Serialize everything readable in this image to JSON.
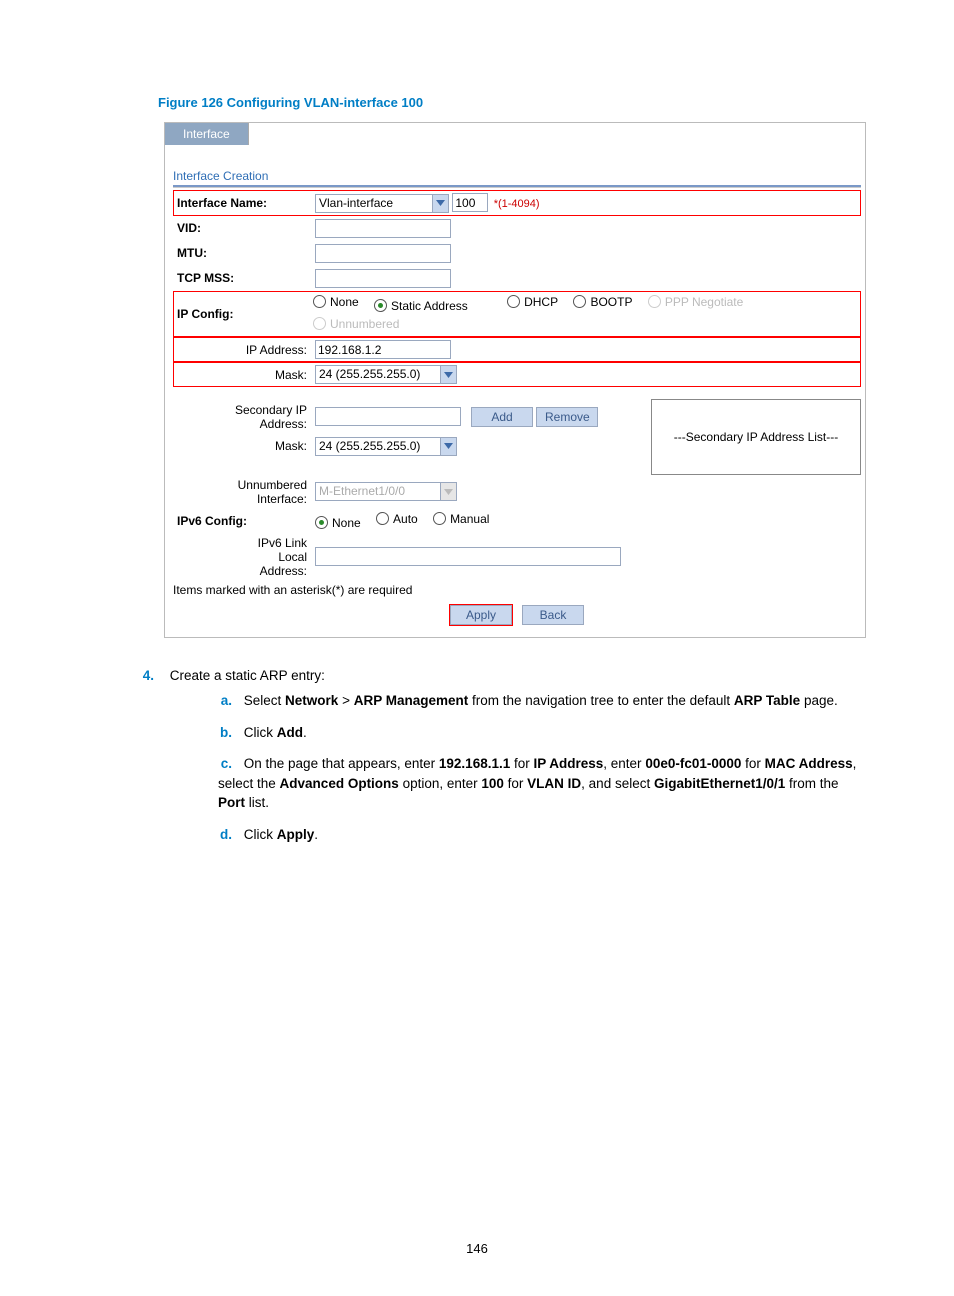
{
  "figure_caption": "Figure 126 Configuring VLAN-interface 100",
  "tab_label": "Interface",
  "section_title": "Interface Creation",
  "labels": {
    "interface_name": "Interface Name:",
    "vid": "VID:",
    "mtu": "MTU:",
    "tcp_mss": "TCP MSS:",
    "ip_config": "IP Config:",
    "ip_address": "IP Address:",
    "mask": "Mask:",
    "secondary_ip": "Secondary IP\nAddress:",
    "mask2": "Mask:",
    "unnumbered_if": "Unnumbered\nInterface:",
    "ipv6_config": "IPv6 Config:",
    "ipv6_link": "IPv6 Link\nLocal\nAddress:"
  },
  "fields": {
    "interface_type": "Vlan-interface",
    "interface_id": "100",
    "interface_id_hint": "*(1-4094)",
    "vid": "",
    "mtu": "",
    "tcp_mss": "",
    "ip_address": "192.168.1.2",
    "mask": "24 (255.255.255.0)",
    "secondary_ip": "",
    "mask2": "24 (255.255.255.0)",
    "unnumbered_if": "M-Ethernet1/0/0",
    "ipv6_link": ""
  },
  "ip_config_options": {
    "none": "None",
    "static": "Static Address",
    "dhcp": "DHCP",
    "bootp": "BOOTP",
    "ppp": "PPP Negotiate",
    "unnumbered": "Unnumbered"
  },
  "ipv6_options": {
    "none": "None",
    "auto": "Auto",
    "manual": "Manual"
  },
  "secondary_list_header": "---Secondary IP Address List---",
  "buttons": {
    "add": "Add",
    "remove": "Remove",
    "apply": "Apply",
    "back": "Back"
  },
  "footnote": "Items marked with an asterisk(*) are required",
  "steps": {
    "num": "4.",
    "title": "Create a static ARP entry:",
    "a": {
      "k": "a.",
      "pre": "Select ",
      "b1": "Network",
      "mid1": " > ",
      "b2": "ARP Management",
      "mid2": " from the navigation tree to enter the default ",
      "b3": "ARP Table",
      "post": " page."
    },
    "b": {
      "k": "b.",
      "pre": "Click ",
      "b1": "Add",
      "post": "."
    },
    "c": {
      "k": "c.",
      "t1": "On the page that appears, enter ",
      "b1": "192.168.1.1",
      "t2": " for ",
      "b2": "IP Address",
      "t3": ", enter ",
      "b3": "00e0-fc01-0000",
      "t4": " for ",
      "b4": "MAC Address",
      "t5": ", select the ",
      "b5": "Advanced Options",
      "t6": " option, enter ",
      "b6": "100",
      "t7": " for ",
      "b7": "VLAN ID",
      "t8": ", and select ",
      "b8": "GigabitEthernet1/0/1",
      "t9": " from the ",
      "b9": "Port",
      "t10": " list."
    },
    "d": {
      "k": "d.",
      "pre": "Click ",
      "b1": "Apply",
      "post": "."
    }
  },
  "page_number": "146"
}
